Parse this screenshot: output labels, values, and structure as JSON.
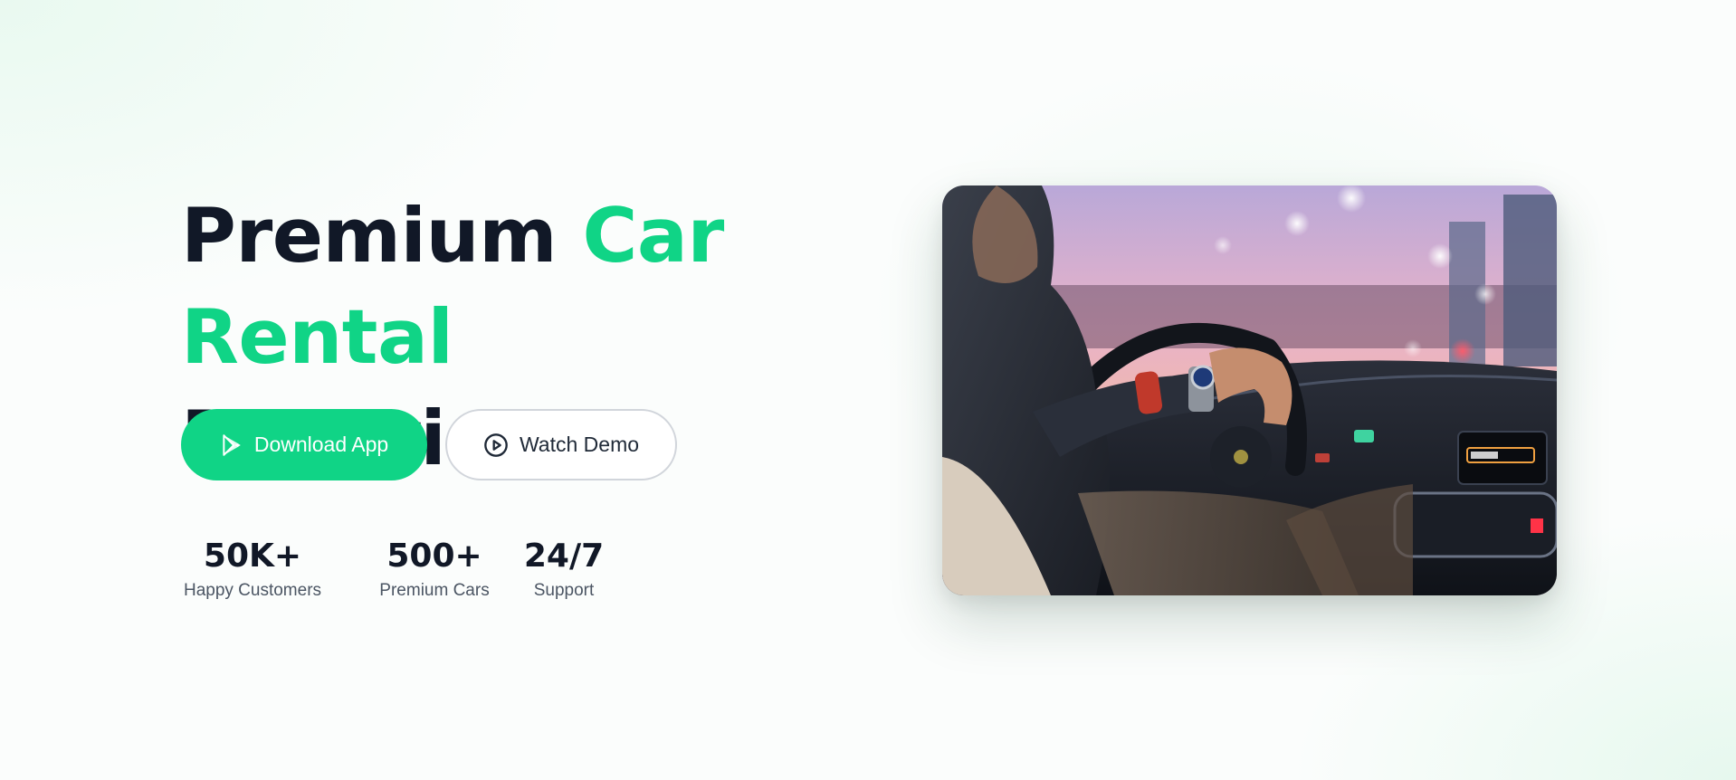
{
  "hero": {
    "headline": {
      "part1": "Premium ",
      "part2": "Car",
      "part3": "Rental",
      "part4": " Experience"
    },
    "buttons": {
      "primary_label": "Download App",
      "primary_icon": "play-store-icon",
      "secondary_label": "Watch Demo",
      "secondary_icon": "play-circle-icon"
    },
    "stats": [
      {
        "value": "50K+",
        "label": "Happy Customers"
      },
      {
        "value": "500+",
        "label": "Premium Cars"
      },
      {
        "value": "24/7",
        "label": "Support"
      }
    ],
    "image": {
      "description_icon": "driver-photo"
    }
  },
  "colors": {
    "accent": "#10d486",
    "text_dark": "#111827",
    "text_muted": "#4b5563"
  }
}
